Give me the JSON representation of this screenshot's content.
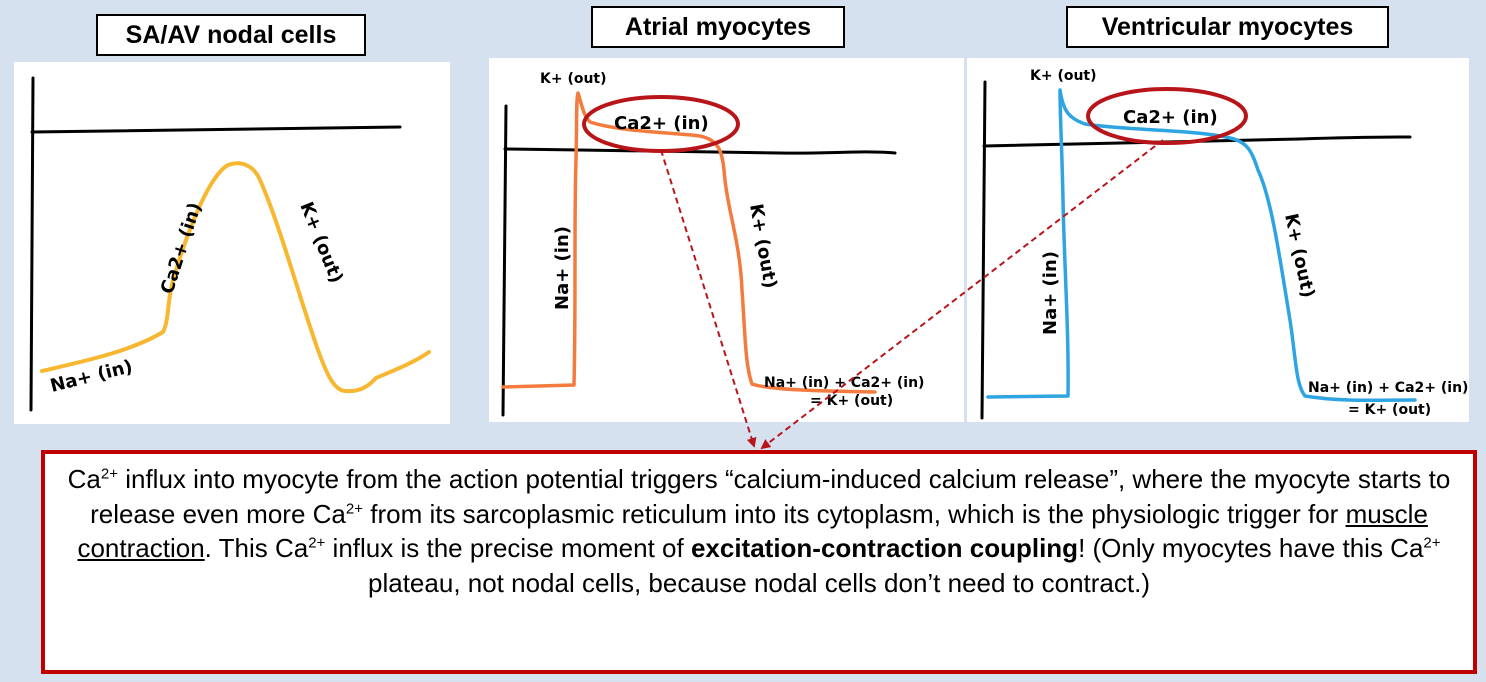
{
  "panels": {
    "nodal": {
      "title": "SA/AV nodal cells",
      "labels": {
        "na_in": "Na+ (in)",
        "ca_in": "Ca2+ (in)",
        "k_out": "K+ (out)"
      },
      "trace_color": "#f7b731"
    },
    "atrial": {
      "title": "Atrial myocytes",
      "labels": {
        "k_out_top": "K+ (out)",
        "ca_in": "Ca2+ (in)",
        "na_in": "Na+ (in)",
        "k_out": "K+ (out)",
        "rest_line1": "Na+ (in) + Ca2+ (in)",
        "rest_line2": "= K+ (out)"
      },
      "trace_color": "#f47b3e"
    },
    "ventricular": {
      "title": "Ventricular myocytes",
      "labels": {
        "k_out_top": "K+ (out)",
        "ca_in": "Ca2+ (in)",
        "na_in": "Na+ (in)",
        "k_out": "K+ (out)",
        "rest_line1": "Na+ (in) + Ca2+ (in)",
        "rest_line2": "= K+ (out)"
      },
      "trace_color": "#2ea4e0"
    }
  },
  "highlight_color": "#b8151b",
  "caption": {
    "s1a": "Ca",
    "sup": "2+",
    "s1b": " influx into myocyte from the action potential triggers “calcium-induced calcium release”, where the myocyte starts to release even more Ca",
    "s1c": " from its sarcoplasmic reticulum into its cytoplasm, which is the physiologic trigger for ",
    "underlined": "muscle contraction",
    "s2a": ". This Ca",
    "s2b": " influx is the precise moment of ",
    "bold": "excitation-contraction coupling",
    "s2c": "! (Only myocytes have this Ca",
    "s2d": " plateau, not nodal cells, because nodal cells don’t need to contract.)"
  }
}
